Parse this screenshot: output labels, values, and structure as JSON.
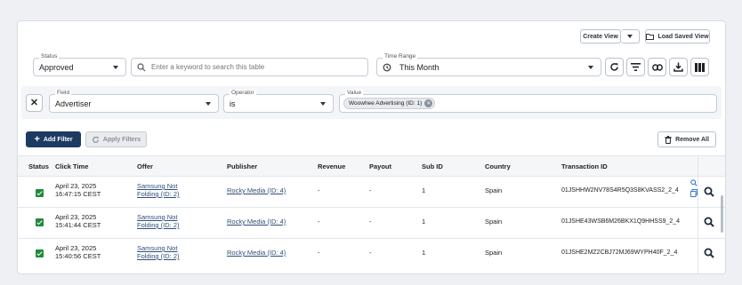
{
  "toolbar": {
    "create_view": "Create View",
    "load_saved_view": "Load Saved View"
  },
  "filters": {
    "status": {
      "label": "Status",
      "value": "Approved"
    },
    "search": {
      "placeholder": "Enter a keyword to search this table"
    },
    "time_range": {
      "label": "Time Range",
      "value": "This Month"
    }
  },
  "rule": {
    "field": {
      "label": "Field",
      "value": "Advertiser"
    },
    "operator": {
      "label": "Operator",
      "value": "is"
    },
    "value": {
      "label": "Value",
      "chip": "Woowhee Advertising (ID: 1)"
    }
  },
  "actions": {
    "add_filter": "Add Filter",
    "apply_filters": "Apply Filters",
    "remove_all": "Remove All"
  },
  "table": {
    "headers": [
      "Status",
      "Click Time",
      "Offer",
      "Publisher",
      "Revenue",
      "Payout",
      "Sub ID",
      "Country",
      "Transaction ID"
    ],
    "rows": [
      {
        "date": "April 23, 2025",
        "time": "16:47:15 CEST",
        "offer1": "Samsung Not",
        "offer2": "Folding (ID: 2)",
        "publisher": "Rocky Media (ID: 4)",
        "revenue": "-",
        "payout": "-",
        "sub_id": "1",
        "country": "Spain",
        "transaction": "01JSHHW2NV78S4R5Q3S8KVASS2_2_4"
      },
      {
        "date": "April 23, 2025",
        "time": "15:41:44 CEST",
        "offer1": "Samsung Not",
        "offer2": "Folding (ID: 2)",
        "publisher": "Rocky Media (ID: 4)",
        "revenue": "-",
        "payout": "-",
        "sub_id": "1",
        "country": "Spain",
        "transaction": "01JSHE43WSB6M26BKX1Q9HHSS9_2_4"
      },
      {
        "date": "April 23, 2025",
        "time": "15:40:56 CEST",
        "offer1": "Samsung Not",
        "offer2": "Folding (ID: 2)",
        "publisher": "Rocky Media (ID: 4)",
        "revenue": "-",
        "payout": "-",
        "sub_id": "1",
        "country": "Spain",
        "transaction": "01JSHE2MZ2CBJ72MJ69WYPH40F_2_4"
      }
    ]
  },
  "colors": {
    "primary": "#1d3a63",
    "approved": "#1f8a3a",
    "border": "#c6ccd5"
  }
}
